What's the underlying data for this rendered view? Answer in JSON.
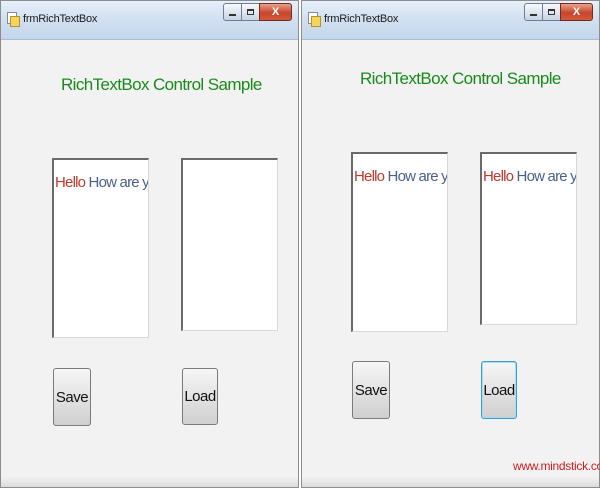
{
  "windows": [
    {
      "title": "frmRichTextBox",
      "heading": "RichTextBox Control Sample",
      "rtb1": {
        "hello": "Hello",
        "rest": " How are you"
      },
      "rtb2": {
        "hello": "",
        "rest": ""
      },
      "save_label": "Save",
      "load_label": "Load",
      "close_glyph": "X"
    },
    {
      "title": "frmRichTextBox",
      "heading": "RichTextBox Control Sample",
      "rtb1": {
        "hello": "Hello",
        "rest": " How are you"
      },
      "rtb2": {
        "hello": "Hello",
        "rest": " How are you"
      },
      "save_label": "Save",
      "load_label": "Load",
      "close_glyph": "X",
      "watermark": "www.mindstick.com"
    }
  ],
  "colors": {
    "heading": "#1a8a1a",
    "hello_text": "#c0392b",
    "body_text": "#4a5f8c",
    "watermark": "#cc1f1f"
  }
}
